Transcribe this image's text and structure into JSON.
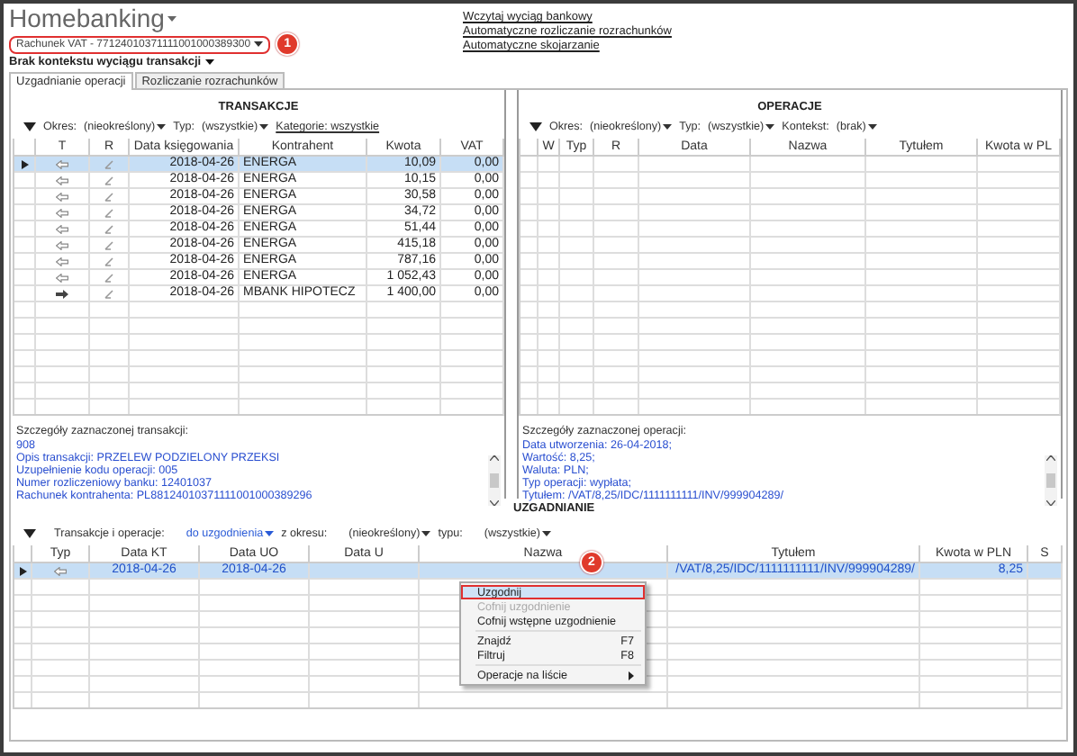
{
  "app": {
    "title": "Homebanking"
  },
  "account": {
    "label": "Rachunek VAT - 77124010371111001000389300",
    "badge": "1"
  },
  "links": [
    "Wczytaj wyciąg bankowy",
    "Automatyczne rozliczanie rozrachunków",
    "Automatyczne skojarzanie"
  ],
  "context_label": "Brak kontekstu wyciągu transakcji",
  "tabs": [
    {
      "label": "Uzgadnianie operacji",
      "selected": true
    },
    {
      "label": "Rozliczanie rozrachunków",
      "selected": false
    }
  ],
  "transactions": {
    "title": "TRANSAKCJE",
    "filters": [
      {
        "label": "Okres:",
        "value": "(nieokreślony)"
      },
      {
        "label": "Typ:",
        "value": "(wszystkie)"
      }
    ],
    "link": "Kategorie: wszystkie",
    "columns": [
      "T",
      "R",
      "Data księgowania",
      "Kontrahent",
      "Kwota",
      "VAT"
    ],
    "rows": [
      {
        "kind": "debit",
        "selected": true,
        "date": "2018-04-26",
        "name": "ENERGA",
        "amount": "10,09",
        "vat": "0,00"
      },
      {
        "kind": "debit",
        "selected": false,
        "date": "2018-04-26",
        "name": "ENERGA",
        "amount": "10,15",
        "vat": "0,00"
      },
      {
        "kind": "debit",
        "selected": false,
        "date": "2018-04-26",
        "name": "ENERGA",
        "amount": "30,58",
        "vat": "0,00"
      },
      {
        "kind": "debit",
        "selected": false,
        "date": "2018-04-26",
        "name": "ENERGA",
        "amount": "34,72",
        "vat": "0,00"
      },
      {
        "kind": "debit",
        "selected": false,
        "date": "2018-04-26",
        "name": "ENERGA",
        "amount": "51,44",
        "vat": "0,00"
      },
      {
        "kind": "debit",
        "selected": false,
        "date": "2018-04-26",
        "name": "ENERGA",
        "amount": "415,18",
        "vat": "0,00"
      },
      {
        "kind": "debit",
        "selected": false,
        "date": "2018-04-26",
        "name": "ENERGA",
        "amount": "787,16",
        "vat": "0,00"
      },
      {
        "kind": "debit",
        "selected": false,
        "date": "2018-04-26",
        "name": "ENERGA",
        "amount": "1 052,43",
        "vat": "0,00"
      },
      {
        "kind": "credit",
        "selected": false,
        "date": "2018-04-26",
        "name": "MBANK HIPOTECZ",
        "amount": "1 400,00",
        "vat": "0,00"
      }
    ],
    "details_label": "Szczegóły zaznaczonej transakcji:",
    "details": [
      "908",
      "Opis transakcji: PRZELEW PODZIELONY PRZEKSI",
      "Uzupełnienie kodu operacji: 005",
      "Numer rozliczeniowy banku: 12401037",
      "Rachunek kontrahenta: PL88124010371111001000389296"
    ]
  },
  "operations": {
    "title": "OPERACJE",
    "filters": [
      {
        "label": "Okres:",
        "value": "(nieokreślony)"
      },
      {
        "label": "Typ:",
        "value": "(wszystkie)"
      },
      {
        "label": "Kontekst:",
        "value": "(brak)"
      }
    ],
    "columns": [
      "W",
      "Typ",
      "R",
      "Data",
      "Nazwa",
      "Tytułem",
      "Kwota w PL"
    ],
    "details_label": "Szczegóły zaznaczonej operacji:",
    "details": [
      "Data utworzenia: 26-04-2018;",
      "Wartość: 8,25;",
      "Waluta: PLN;",
      "Typ operacji: wypłata;",
      "Tytułem: /VAT/8,25/IDC/1111111111/INV/999904289/"
    ]
  },
  "reconciliation": {
    "title": "UZGADNIANIE",
    "filter_label": "Transakcje i operacje:",
    "filter_value": "do uzgodnienia",
    "period_label": "z okresu:",
    "period_value": "(nieokreślony)",
    "type_label": "typu:",
    "type_value": "(wszystkie)",
    "columns": [
      "Typ",
      "Data KT",
      "Data UO",
      "Data U",
      "Nazwa",
      "Tytułem",
      "Kwota w PLN",
      "S"
    ],
    "rows": [
      {
        "kind": "debit",
        "selected": true,
        "date_kt": "2018-04-26",
        "date_uo": "2018-04-26",
        "title": "/VAT/8,25/IDC/1111111111/INV/999904289/",
        "amount": "8,25"
      }
    ],
    "badge": "2"
  },
  "context_menu": [
    {
      "kind": "item",
      "label": "Uzgodnij",
      "highlighted": true,
      "disabled": false
    },
    {
      "kind": "item",
      "label": "Cofnij uzgodnienie",
      "highlighted": false,
      "disabled": true
    },
    {
      "kind": "item",
      "label": "Cofnij wstępne uzgodnienie",
      "highlighted": false,
      "disabled": false
    },
    {
      "kind": "separator"
    },
    {
      "kind": "item",
      "label": "Znajdź",
      "shortcut": "F7",
      "highlighted": false,
      "disabled": false
    },
    {
      "kind": "item",
      "label": "Filtruj",
      "shortcut": "F8",
      "highlighted": false,
      "disabled": false
    },
    {
      "kind": "separator"
    },
    {
      "kind": "item",
      "label": "Operacje na liście",
      "submenu": true,
      "highlighted": false,
      "disabled": false
    }
  ]
}
